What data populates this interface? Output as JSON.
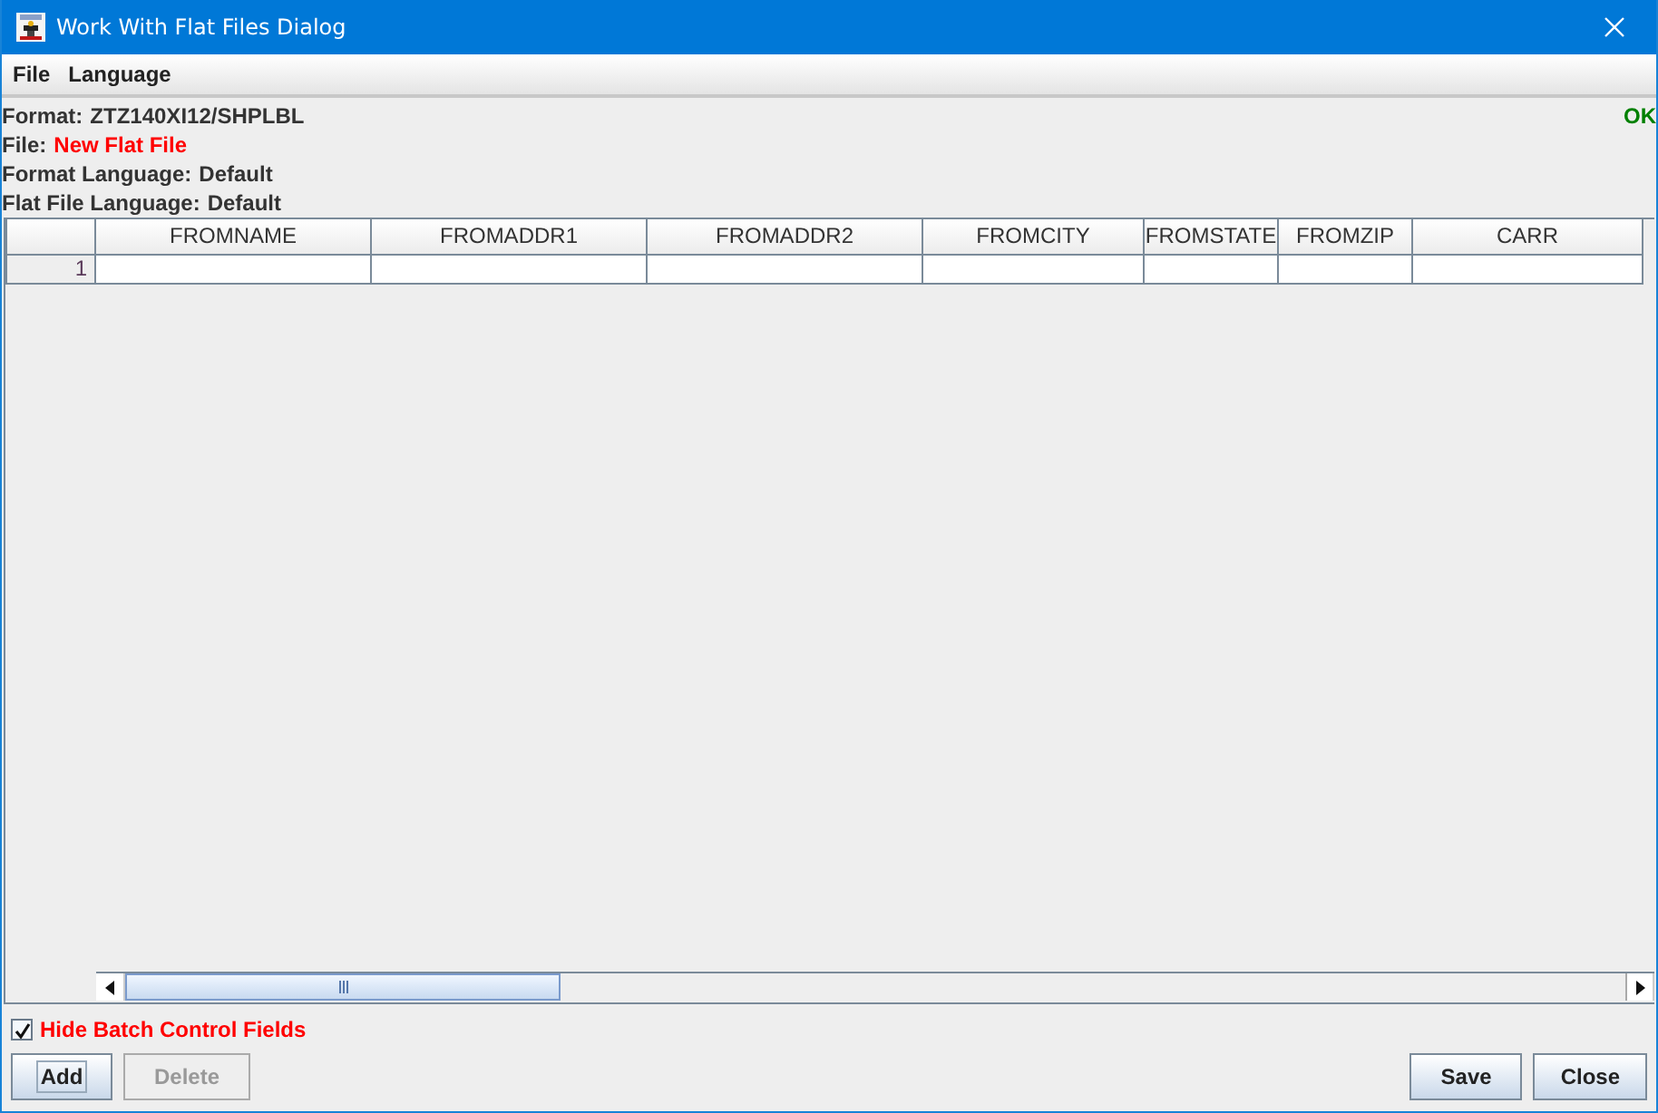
{
  "window": {
    "title": "Work With Flat Files Dialog"
  },
  "menu": [
    "File",
    "Language"
  ],
  "info_lines": [
    {
      "label": "Format:",
      "value": "ZTZ140XI12/SHPLBL",
      "highlight": false
    },
    {
      "label": "File:",
      "value": "New Flat File",
      "highlight": true
    },
    {
      "label": "Format Language:",
      "value": "Default",
      "highlight": false
    },
    {
      "label": "Flat File Language:",
      "value": "Default",
      "highlight": false
    }
  ],
  "status": "OK",
  "table": {
    "columns": [
      "FROMNAME",
      "FROMADDR1",
      "FROMADDR2",
      "FROMCITY",
      "FROMSTATE",
      "FROMZIP",
      "CARR"
    ],
    "rows": [
      {
        "row_number": "1"
      }
    ]
  },
  "checkbox": {
    "label": "Hide Batch Control Fields",
    "checked": true
  },
  "buttons_left": [
    {
      "label": "Add",
      "disabled": false,
      "focused": true
    },
    {
      "label": "Delete",
      "disabled": true,
      "focused": false
    }
  ],
  "buttons_right": [
    {
      "label": "Save",
      "disabled": false,
      "focused": false
    },
    {
      "label": "Close",
      "disabled": false,
      "focused": false
    }
  ]
}
